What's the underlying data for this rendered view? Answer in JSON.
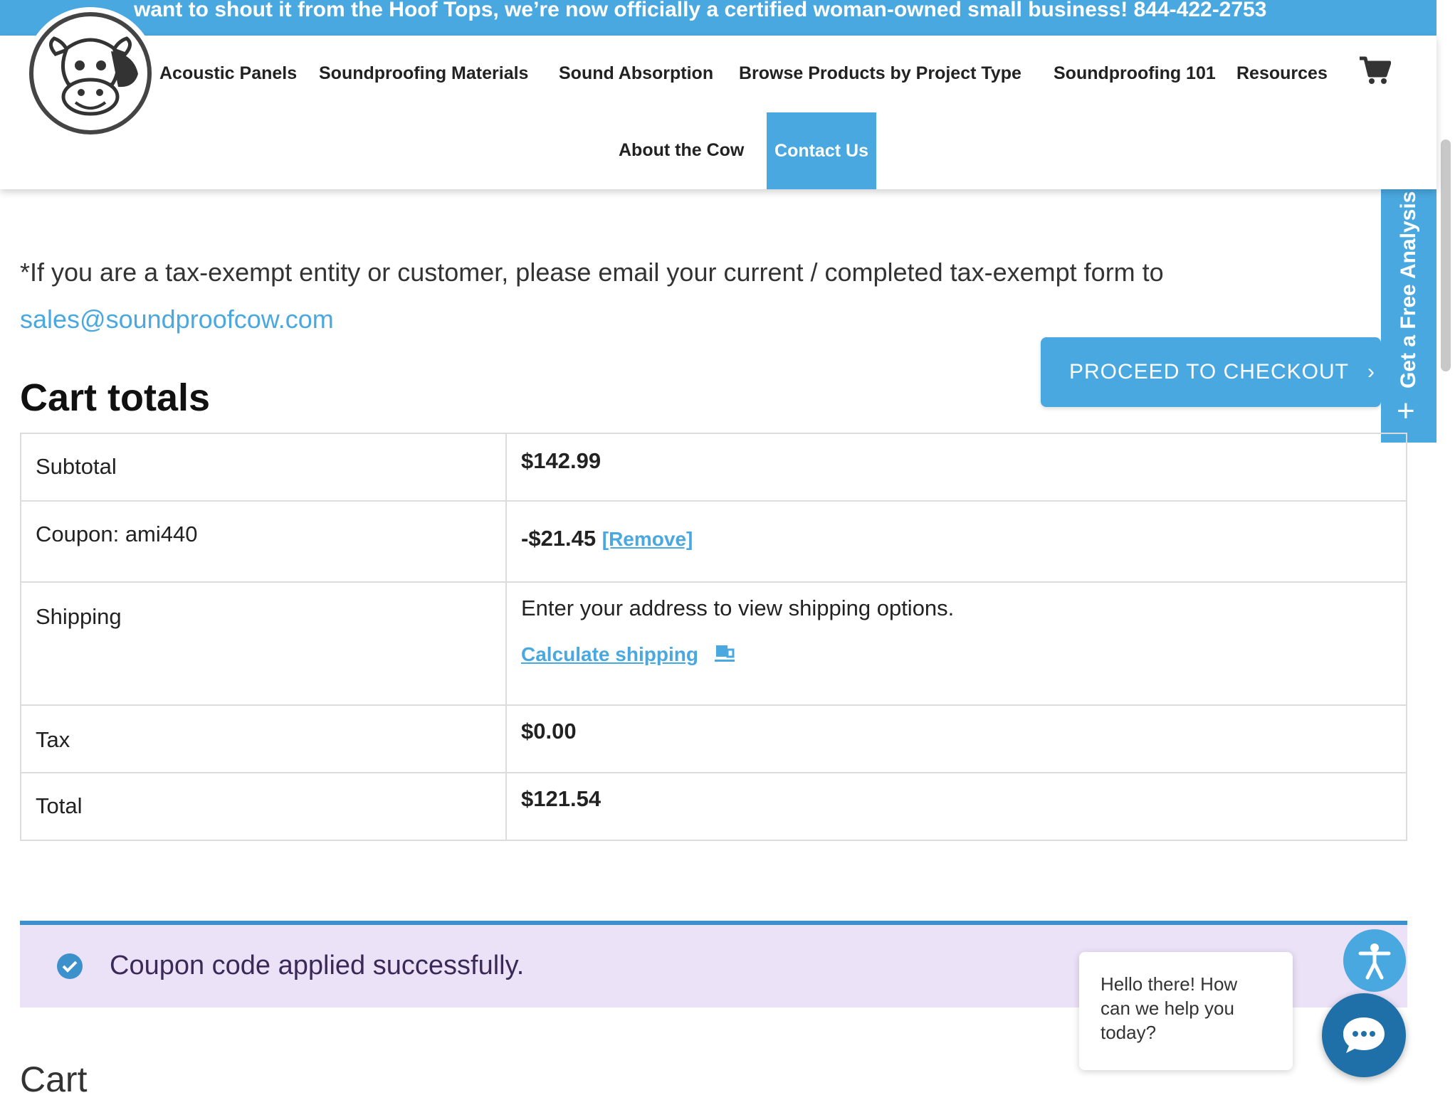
{
  "announcement": "want to shout it from the Hoof Tops, we’re now officially a certified woman-owned small business! 844-422-2753",
  "nav": {
    "items": [
      "Acoustic Panels",
      "Soundproofing Materials",
      "Sound Absorption",
      "Browse Products by Project Type",
      "Soundproofing 101",
      "Resources",
      "About the Cow"
    ],
    "contact": "Contact Us"
  },
  "tax_note": {
    "text": "*If you are a tax-exempt entity or customer, please email your current / completed tax-exempt form to",
    "email": "sales@soundproofcow.com"
  },
  "cart_totals": {
    "title": "Cart totals",
    "subtotal_label": "Subtotal",
    "subtotal_value": "$142.99",
    "coupon_label": "Coupon: ami440",
    "coupon_value": "-$21.45",
    "coupon_remove": "[Remove]",
    "shipping_label": "Shipping",
    "shipping_text": "Enter your address to view shipping options.",
    "shipping_link": "Calculate shipping",
    "tax_label": "Tax",
    "tax_value": "$0.00",
    "total_label": "Total",
    "total_value": "$121.54"
  },
  "checkout_button": "PROCEED TO CHECKOUT",
  "side_tab": "Get a Free Analysis",
  "notice": "Coupon code applied successfully.",
  "cart_heading": "Cart",
  "chat": {
    "message": "Hello there! How can we help you today?"
  },
  "colors": {
    "brand_blue": "#4aa8e0",
    "notice_bg": "#ece2f8",
    "chat_blue": "#1f6fa8"
  }
}
